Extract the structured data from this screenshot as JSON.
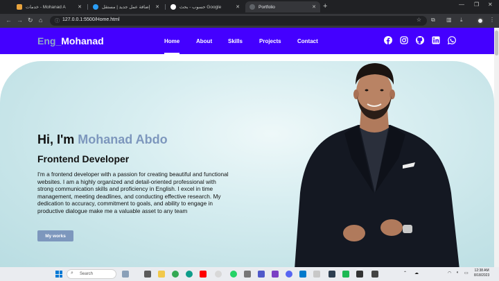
{
  "browser": {
    "tabs": [
      {
        "title": "خدمات - Mohanad A",
        "favicon_color": "#e8a33d"
      },
      {
        "title": "إضافة عمل جديد | مستقل",
        "favicon_color": "#2a9df4"
      },
      {
        "title": "حسوب - بحث Google",
        "favicon_color": "#ffffff"
      },
      {
        "title": "Portfolio",
        "favicon_color": "#5f6368"
      }
    ],
    "active_tab": 3,
    "url": "127.0.0.1:5500/Home.html"
  },
  "site": {
    "logo_prefix": "Eng_",
    "logo_name": "Mohanad",
    "nav": [
      "Home",
      "About",
      "Skills",
      "Projects",
      "Contact"
    ],
    "social_icons": [
      "facebook-icon",
      "instagram-icon",
      "github-icon",
      "linkedin-icon",
      "whatsapp-icon"
    ]
  },
  "hero": {
    "greeting": "Hi, I'm ",
    "name": "Mohanad Abdo",
    "role": "Frontend Developer",
    "bio": "I'm a frontend developer with a passion for creating beautiful and functional websites. I am a highly organized and detail-oriented professional with strong communication skills and proficiency in English. I excel in time management, meeting deadlines, and conducting effective research. My dedication to accuracy, commitment to goals, and ability to engage in productive dialogue make me a valuable asset to any team",
    "cta": "My works"
  },
  "taskbar": {
    "search_label": "Search",
    "time": "12:38 AM",
    "date": "8/18/2023"
  },
  "colors": {
    "nav_bg": "#4400ff",
    "accent": "#7d97bd",
    "button": "#7d97bd"
  }
}
